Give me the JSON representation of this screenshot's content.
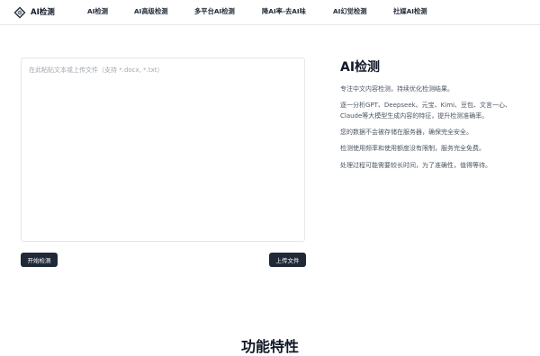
{
  "header": {
    "logo_text": "AI检测",
    "logo_icon": "diamond-logo-icon",
    "nav": [
      {
        "label": "AI检测"
      },
      {
        "label": "AI高级检测"
      },
      {
        "label": "多平台AI检测"
      },
      {
        "label": "降AI率-去AI味"
      },
      {
        "label": "AI幻觉检测"
      },
      {
        "label": "社媒AI检测"
      }
    ]
  },
  "editor": {
    "placeholder": "在此粘贴文本或上传文件（支持 *.docx, *.txt）",
    "value": ""
  },
  "buttons": {
    "start": "开始检测",
    "upload": "上传文件"
  },
  "info": {
    "title": "AI检测",
    "paragraphs": [
      "专注中文内容检测，持续优化检测结果。",
      "逐一分析GPT、Deepseek、元宝、Kimi、豆包、文言一心、Claude等大模型生成内容的特征，提升检测准确率。",
      "您的数据不会被存储在服务器，确保完全安全。",
      "检测使用频率和使用额度没有限制，服务完全免费。",
      "处理过程可能需要较长时间，为了准确性，值得等待。"
    ]
  },
  "features": {
    "title": "功能特性"
  },
  "colors": {
    "primary": "#1f2937",
    "border": "#e5e7eb",
    "muted_text": "#4b5563"
  }
}
